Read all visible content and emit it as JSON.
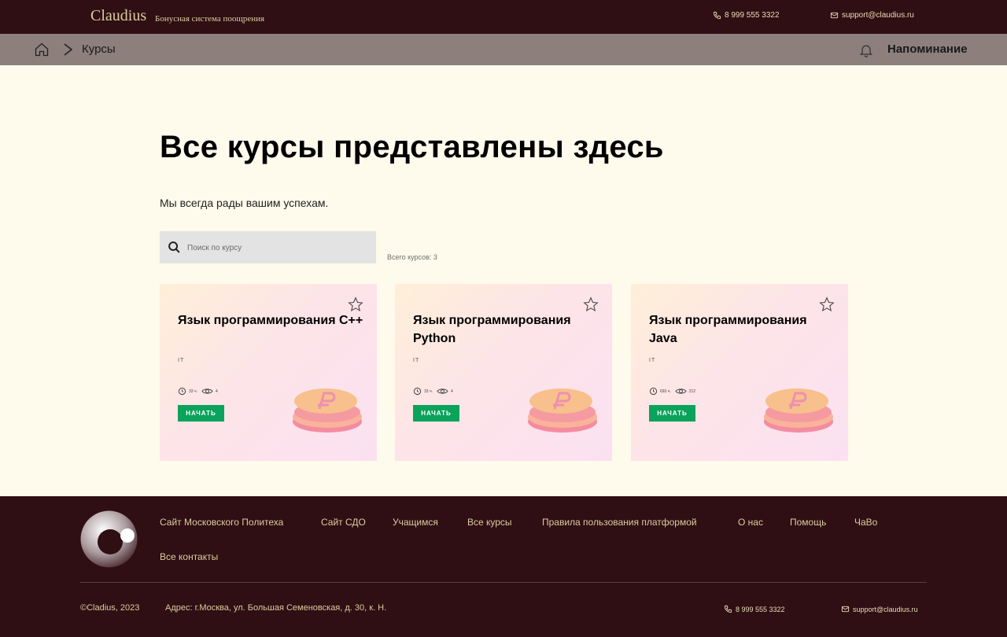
{
  "header": {
    "brand": "Claudius",
    "tagline": "Бонусная система поощрения",
    "phone": "8 999 555 3322",
    "email": "support@claudius.ru"
  },
  "breadcrumb": {
    "current": "Курсы",
    "reminder_label": "Напоминание"
  },
  "main": {
    "title": "Все курсы представлены здесь",
    "subtitle": "Мы всегда рады вашим успехам.",
    "search_placeholder": "Поиск по курсу",
    "total_label": "Всего курсов: 3"
  },
  "courses": [
    {
      "title": "Язык программирования C++",
      "category": "IT",
      "hours": "33 ч.",
      "views": "4",
      "button": "НАЧАТЬ"
    },
    {
      "title": "Язык программирования Python",
      "category": "IT",
      "hours": "33 ч.",
      "views": "4",
      "button": "НАЧАТЬ"
    },
    {
      "title": "Язык программирования Java",
      "category": "IT",
      "hours": "693 ч.",
      "views": "212",
      "button": "НАЧАТЬ"
    }
  ],
  "footer": {
    "links": [
      "Сайт Московского Политеха",
      "Сайт СДО",
      "Учащимся",
      "Все курсы",
      "Правила пользования платформой",
      "О нас",
      "Помощь",
      "ЧаВо",
      "Все контакты"
    ],
    "copyright": "©Cladius, 2023",
    "address": "Адрес: г.Москва, ул. Большая Семеновская, д. 30, к. Н.",
    "phone": "8 999 555 3322",
    "email": "support@claudius.ru"
  },
  "colors": {
    "header_bg": "#2f0e14",
    "breadcrumb_bg": "#8d807c",
    "page_bg": "#fefaec",
    "accent_green": "#0aa35b",
    "footer_text": "#d9cf9c"
  },
  "icons": [
    "phone-icon",
    "mail-icon",
    "home-icon",
    "chevron-right-icon",
    "bell-icon",
    "search-icon",
    "star-icon",
    "clock-icon",
    "eye-icon",
    "coins-icon",
    "logo-icon"
  ]
}
